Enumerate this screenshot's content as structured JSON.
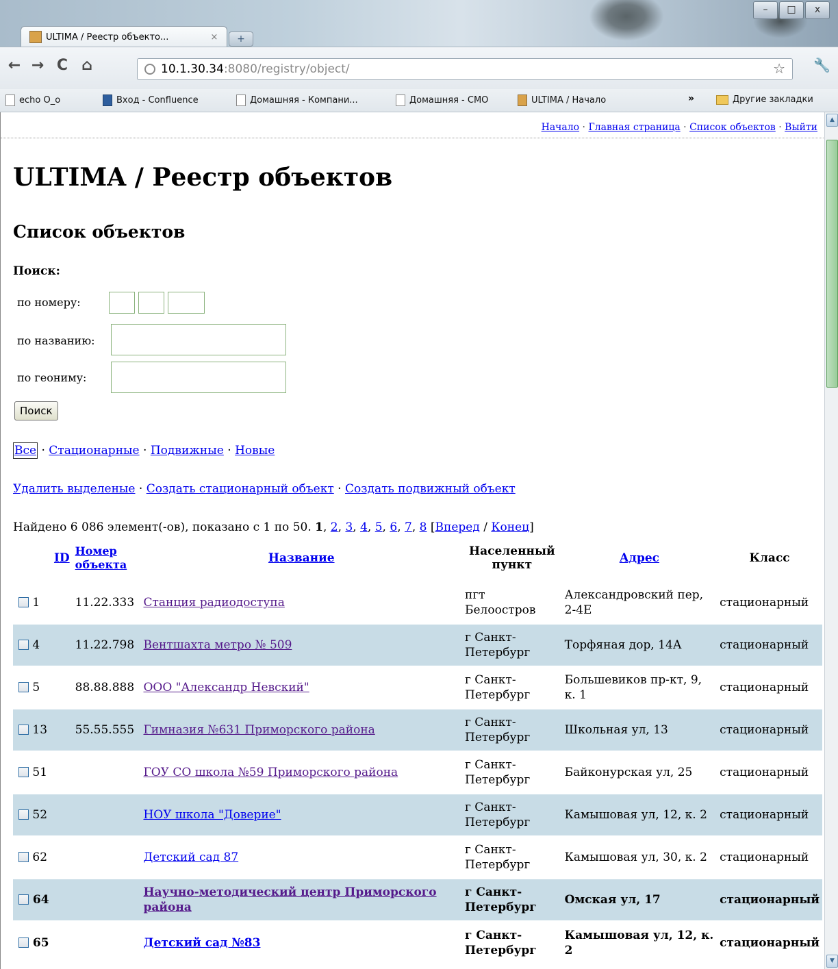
{
  "browser": {
    "tab_title": "ULTIMA / Реестр объекто...",
    "tab_close": "×",
    "new_tab": "+",
    "url_host": "10.1.30.34",
    "url_path": ":8080/registry/object/",
    "bookmarks": [
      {
        "label": "echo O_o",
        "icon": "page-icon"
      },
      {
        "label": "Вход - Confluence",
        "icon": "confluence-icon"
      },
      {
        "label": "Домашняя - Компани...",
        "icon": "page-icon"
      },
      {
        "label": "Домашняя - СМО",
        "icon": "page-icon"
      },
      {
        "label": "ULTIMA / Начало",
        "icon": "ultima-icon"
      }
    ],
    "bookmarks_more": "»",
    "other_bookmarks": "Другие закладки",
    "window_buttons": [
      "–",
      "□",
      "x"
    ]
  },
  "topnav": {
    "items": [
      "Начало",
      "Главная страница",
      "Список объектов",
      "Выйти"
    ],
    "sep": " · "
  },
  "page": {
    "title": "ULTIMA / Реестр объектов",
    "subtitle": "Список объектов"
  },
  "search": {
    "label": "Поиск:",
    "by_number": "по номеру:",
    "by_name": "по названию:",
    "by_geonym": "по геониму:",
    "button": "Поиск"
  },
  "filters": [
    "Все",
    "Стационарные",
    "Подвижные",
    "Новые"
  ],
  "actions": [
    "Удалить выделеные",
    "Создать стационарный объект",
    "Создать подвижный объект"
  ],
  "pagination": {
    "found_text": "Найдено 6 086 элемент(-ов), показано с 1 по 50.",
    "current": "1",
    "pages": [
      "2",
      "3",
      "4",
      "5",
      "6",
      "7",
      "8"
    ],
    "next": "Вперед",
    "last": "Конец"
  },
  "table": {
    "headers": {
      "id": "ID",
      "number": "Номер объекта",
      "name": "Название",
      "city": "Населенный пункт",
      "address": "Адрес",
      "class": "Класс"
    },
    "rows": [
      {
        "id": "1",
        "number": "11.22.333",
        "name": "Станция радиодоступа",
        "city": "пгт Белоостров",
        "address": "Александровский пер, 2-4Е",
        "class": "стационарный"
      },
      {
        "id": "4",
        "number": "11.22.798",
        "name": "Вентшахта метро № 509",
        "city": "г Санкт-Петербург",
        "address": "Торфяная дор, 14А",
        "class": "стационарный"
      },
      {
        "id": "5",
        "number": "88.88.888",
        "name": "ООО \"Александр Невский\"",
        "city": "г Санкт-Петербург",
        "address": "Большевиков пр-кт, 9, к. 1",
        "class": "стационарный"
      },
      {
        "id": "13",
        "number": "55.55.555",
        "name": "Гимназия №631 Приморского района",
        "city": "г Санкт-Петербург",
        "address": "Школьная ул, 13",
        "class": "стационарный"
      },
      {
        "id": "51",
        "number": "",
        "name": "ГОУ СО школа №59 Приморского района",
        "city": "г Санкт-Петербург",
        "address": "Байконурская ул, 25",
        "class": "стационарный"
      },
      {
        "id": "52",
        "number": "",
        "name": "НОУ школа \"Доверие\"",
        "city": "г Санкт-Петербург",
        "address": "Камышовая ул, 12, к. 2",
        "class": "стационарный"
      },
      {
        "id": "62",
        "number": "",
        "name": "Детский сад 87",
        "city": "г Санкт-Петербург",
        "address": "Камышовая ул, 30, к. 2",
        "class": "стационарный"
      },
      {
        "id": "64",
        "number": "",
        "name": "Научно-методический центр Приморского района",
        "city": "г Санкт-Петербург",
        "address": "Омская ул, 17",
        "class": "стационарный"
      },
      {
        "id": "65",
        "number": "",
        "name": "Детский сад №83",
        "city": "г Санкт-Петербург",
        "address": "Камышовая ул, 12, к. 2",
        "class": "стационарный"
      }
    ]
  },
  "colors": {
    "row_alt": "#c8dce6",
    "link": "#0000ee",
    "visited": "#551a8b",
    "input_border": "#8ab27c"
  }
}
